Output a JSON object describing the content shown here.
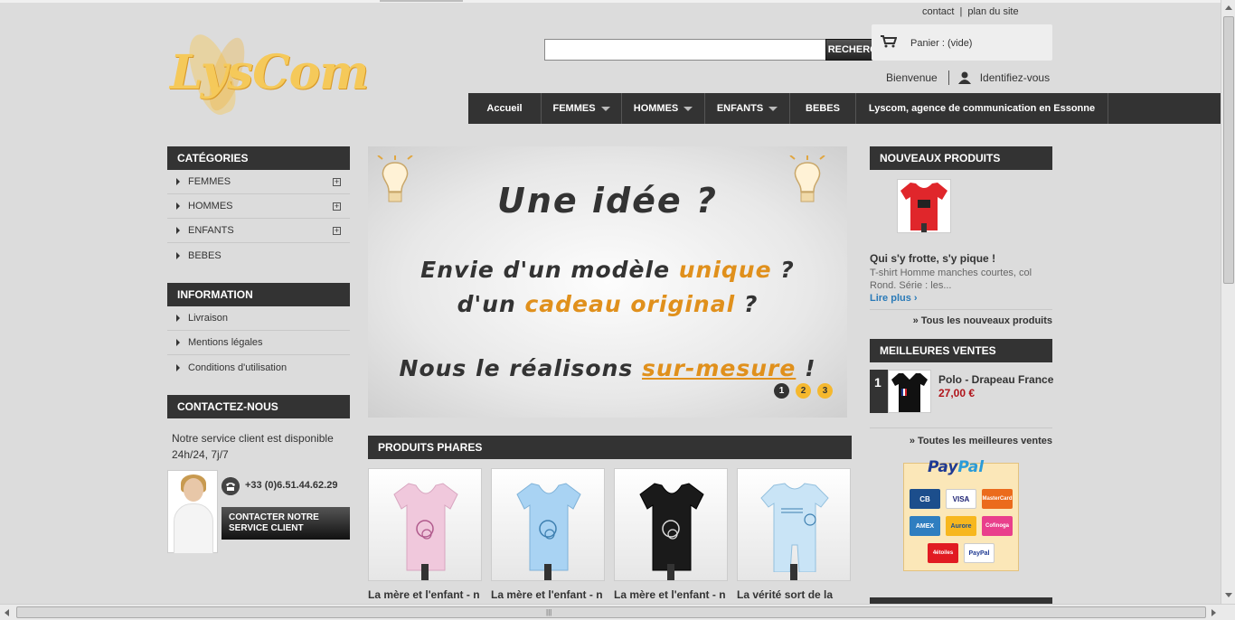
{
  "header": {
    "logo_text": "LysCom",
    "top_links": {
      "contact": "contact",
      "separator": "|",
      "sitemap": "plan du site"
    },
    "search": {
      "placeholder": "",
      "button_label": "RECHERCHER"
    },
    "cart": {
      "label": "Panier : (vide)"
    },
    "welcome": {
      "text": "Bienvenue",
      "login": "Identifiez-vous"
    }
  },
  "nav": {
    "items": [
      {
        "label": "Accueil",
        "has_dropdown": false
      },
      {
        "label": "FEMMES",
        "has_dropdown": true
      },
      {
        "label": "HOMMES",
        "has_dropdown": true
      },
      {
        "label": "ENFANTS",
        "has_dropdown": true
      },
      {
        "label": "BEBES",
        "has_dropdown": false
      },
      {
        "label": "Lyscom, agence de communication en Essonne",
        "has_dropdown": false
      }
    ]
  },
  "categories": {
    "title": "CATÉGORIES",
    "items": [
      {
        "label": "FEMMES",
        "expandable": true
      },
      {
        "label": "HOMMES",
        "expandable": true
      },
      {
        "label": "ENFANTS",
        "expandable": true
      },
      {
        "label": "BEBES",
        "expandable": false
      }
    ],
    "expand_symbol": "+"
  },
  "information": {
    "title": "INFORMATION",
    "items": [
      "Livraison",
      "Mentions légales",
      "Conditions d'utilisation"
    ]
  },
  "contact": {
    "title": "CONTACTEZ-NOUS",
    "text": "Notre service client est disponible 24h/24, 7j/7",
    "phone": "+33 (0)6.51.44.62.29",
    "button_label": "CONTACTER NOTRE SERVICE CLIENT"
  },
  "slider": {
    "line1": "Une idée ?",
    "line2_a": "Envie d'un modèle",
    "line2_b": "unique",
    "line2_c": "?",
    "line3_a": "d'un",
    "line3_b": "cadeau original",
    "line3_c": "?",
    "line4_a": "Nous le réalisons",
    "line4_b": "sur-mesure",
    "line4_c": "!",
    "pager": [
      "1",
      "2",
      "3"
    ],
    "active_page": 1
  },
  "featured": {
    "title": "PRODUITS PHARES",
    "products": [
      {
        "name": "La mère et l'enfant - n",
        "color": "#f0c8dc"
      },
      {
        "name": "La mère et l'enfant - n",
        "color": "#a9d3f3"
      },
      {
        "name": "La mère et l'enfant - n",
        "color": "#1a1a1a"
      },
      {
        "name": "La vérité sort de la",
        "color": "#c9e4f6"
      }
    ]
  },
  "new_products": {
    "title": "NOUVEAUX PRODUITS",
    "product_title": "Qui s'y frotte, s'y pique !",
    "product_desc": "T-shirt Homme manches courtes, col Rond. Série : les...",
    "read_more": "Lire plus",
    "all_link": "» Tous les nouveaux produits"
  },
  "best_sellers": {
    "title": "MEILLEURES VENTES",
    "items": [
      {
        "rank": "1",
        "name": "Polo - Drapeau France",
        "price": "27,00 €"
      }
    ],
    "all_link": "» Toutes les meilleures ventes"
  },
  "payment": {
    "logo_a": "Pay",
    "logo_b": "Pal",
    "cards": [
      "CB",
      "VISA",
      "MasterCard",
      "AMEX",
      "Aurore",
      "Cofinoga",
      "4étoiles",
      "PayPal"
    ]
  },
  "colors": {
    "dark_bar": "#333333",
    "accent_orange": "#e0901c",
    "link_blue": "#2a7ab8",
    "price_red": "#b0141a",
    "page_bg": "#dcdcdc"
  }
}
